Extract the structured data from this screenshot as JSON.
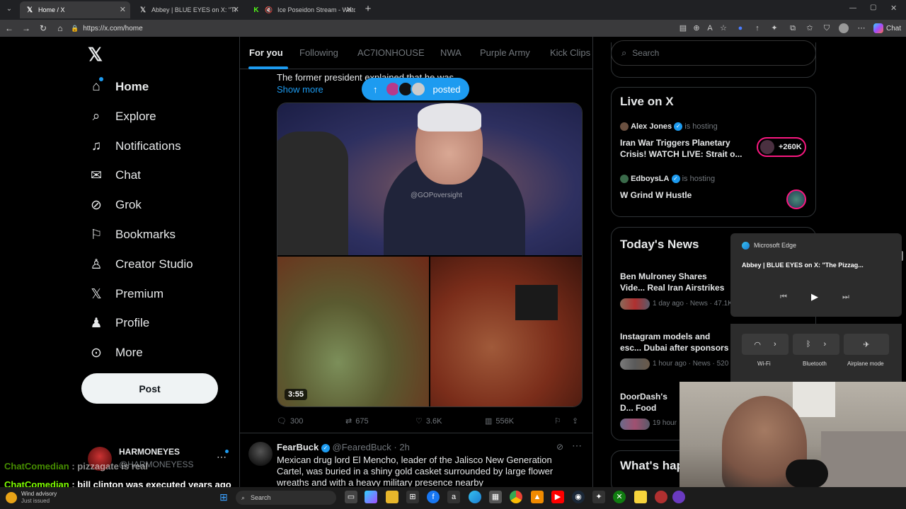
{
  "browser": {
    "tabs": [
      {
        "label": "Home / X",
        "active": true
      },
      {
        "label": "Abbey | BLUE EYES on X: \"The Pizzag",
        "active": false
      },
      {
        "label": "Ice Poseidon Stream - Watch",
        "active": false
      }
    ],
    "url": "https://x.com/home",
    "copilot_label": "Chat"
  },
  "sidebar": {
    "items": [
      {
        "label": "Home",
        "icon": "home-icon"
      },
      {
        "label": "Explore",
        "icon": "search-icon"
      },
      {
        "label": "Notifications",
        "icon": "bell-icon"
      },
      {
        "label": "Chat",
        "icon": "mail-icon"
      },
      {
        "label": "Grok",
        "icon": "grok-icon"
      },
      {
        "label": "Bookmarks",
        "icon": "bookmark-icon"
      },
      {
        "label": "Creator Studio",
        "icon": "creator-icon"
      },
      {
        "label": "Premium",
        "icon": "x-icon"
      },
      {
        "label": "Profile",
        "icon": "person-icon"
      },
      {
        "label": "More",
        "icon": "more-icon"
      }
    ],
    "post_label": "Post",
    "account_name": "HARMONEYES",
    "account_handle": "@HARMONEYESS"
  },
  "feed": {
    "tabs": [
      "For you",
      "Following",
      "AC7IONHOUSE",
      "NWA",
      "Purple Army",
      "Kick Clips"
    ],
    "post1": {
      "text_fragment": "The former president explained that he was",
      "show_more": "Show more",
      "posted_pill": "posted",
      "watermark": "@GOPoversight",
      "duration": "3:55",
      "replies": "300",
      "reposts": "675",
      "likes": "3.6K",
      "views": "556K"
    },
    "post2": {
      "name": "FearBuck",
      "handle": "@FearedBuck",
      "time": "2h",
      "text": "Mexican drug lord El Mencho, leader of the Jalisco New Generation Cartel, was buried in a shiny gold casket surrounded by large flower wreaths and with a heavy military presence nearby"
    }
  },
  "right": {
    "search_placeholder": "Search",
    "live_title": "Live on X",
    "live": [
      {
        "host": "Alex Jones",
        "status": "is hosting",
        "title": "Iran War Triggers Planetary Crisis! WATCH LIVE: Strait o...",
        "count": "+260K"
      },
      {
        "host": "EdboysLA",
        "status": "is hosting",
        "title": "W Grind W Hustle"
      }
    ],
    "news_title": "Today's News",
    "news": [
      {
        "headline": "Ben Mulroney Shares Vide... Real Iran Airstrikes",
        "meta": "1 day ago · News · 47.1K"
      },
      {
        "headline": "Instagram models and esc... Dubai after sponsors leave",
        "meta": "1 hour ago · News · 520"
      },
      {
        "headline": "DoorDash's D... Food Deliverie...",
        "meta": "19 hour"
      }
    ],
    "happening_title": "What's hap"
  },
  "edge_media": {
    "app": "Microsoft Edge",
    "title": "Abbey | BLUE EYES on X: \"The Pizzag..."
  },
  "quick_settings": [
    "Wi-Fi",
    "Bluetooth",
    "Airplane mode"
  ],
  "chat": [
    {
      "user": "ChatComedian",
      "message": " : pizzagate is real"
    },
    {
      "user": "ChatComedian",
      "message": " : bill clinton was executed years ago"
    }
  ],
  "taskbar": {
    "weather_title": "Wind advisory",
    "weather_sub": "Just issued",
    "search_label": "Search"
  },
  "colors": {
    "accent": "#1d9bf0",
    "chat_user": "#7fff00",
    "bg": "#000000"
  }
}
